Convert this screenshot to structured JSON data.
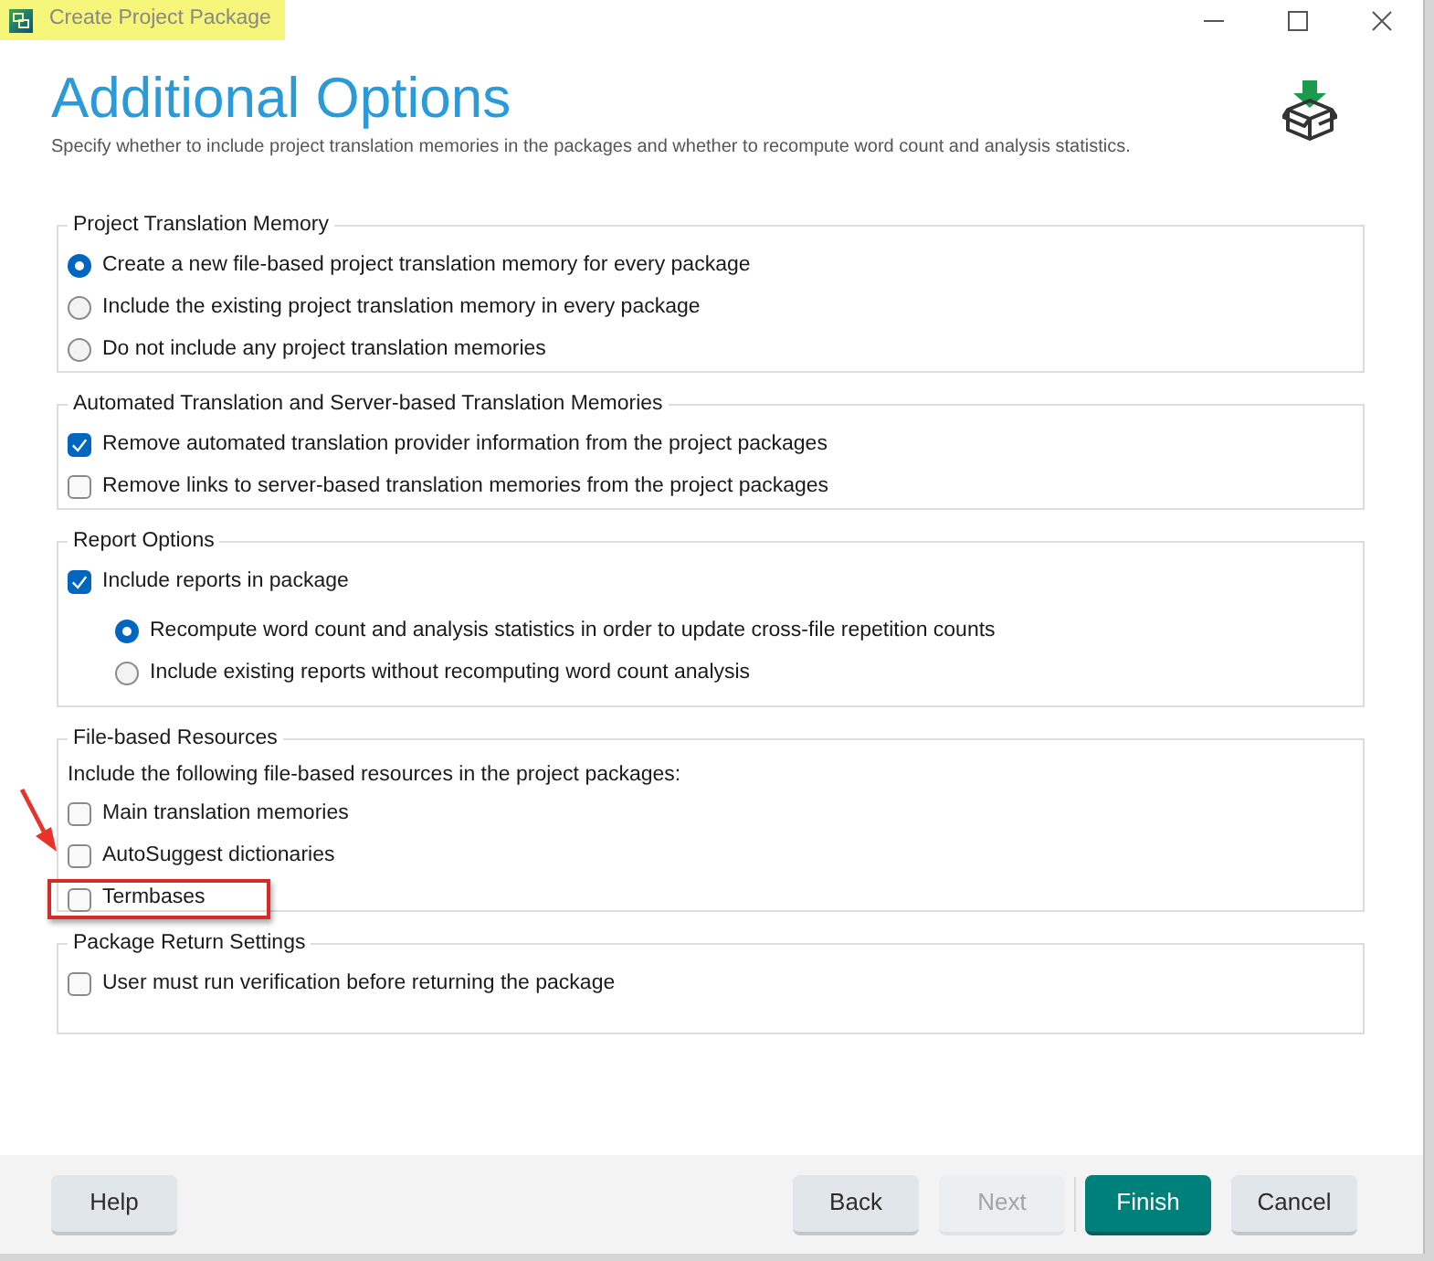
{
  "window": {
    "title": "Create Project Package",
    "highlighted": true
  },
  "header": {
    "title": "Additional Options",
    "subtitle": "Specify whether to include project translation memories in the packages and whether to recompute word count and analysis statistics."
  },
  "groups": [
    {
      "legend": "Project Translation Memory",
      "items": [
        {
          "kind": "radio",
          "label": "Create a new file-based project translation memory for every package",
          "selected": true
        },
        {
          "kind": "radio",
          "label": "Include the existing project translation memory in every package",
          "selected": false
        },
        {
          "kind": "radio",
          "label": "Do not include any project translation memories",
          "selected": false
        }
      ]
    },
    {
      "legend": "Automated Translation and Server-based Translation Memories",
      "items": [
        {
          "kind": "checkbox",
          "label": "Remove automated translation provider information from the project packages",
          "checked": true
        },
        {
          "kind": "checkbox",
          "label": "Remove links to server-based translation memories from the project packages",
          "checked": false
        }
      ]
    },
    {
      "legend": "Report Options",
      "items": [
        {
          "kind": "checkbox",
          "label": "Include reports in package",
          "checked": true,
          "children": [
            {
              "kind": "radio",
              "label": "Recompute word count and analysis statistics in order to update cross-file repetition counts",
              "selected": true
            },
            {
              "kind": "radio",
              "label": "Include existing reports without recomputing word count analysis",
              "selected": false
            }
          ]
        }
      ]
    },
    {
      "legend": "File-based Resources",
      "items": [
        {
          "kind": "text",
          "label": "Include the following file-based resources in the project packages:",
          "annotated": false
        },
        {
          "kind": "checkbox",
          "label": "Main translation memories",
          "checked": false,
          "annotated": false
        },
        {
          "kind": "checkbox",
          "label": "AutoSuggest dictionaries",
          "checked": false,
          "annotated": false
        },
        {
          "kind": "checkbox",
          "label": "Termbases",
          "checked": false,
          "annotated": true
        }
      ]
    },
    {
      "legend": "Package Return Settings",
      "items": [
        {
          "kind": "checkbox",
          "label": "User must run verification before returning the package",
          "checked": false
        }
      ]
    }
  ],
  "footer": {
    "left_buttons": [
      {
        "label": "Help",
        "kind": "standard",
        "disabled": false
      }
    ],
    "right_buttons": [
      {
        "label": "Back",
        "kind": "standard",
        "disabled": false
      },
      {
        "label": "Next",
        "kind": "standard",
        "disabled": true
      },
      {
        "label": "Finish",
        "kind": "primary",
        "disabled": false
      },
      {
        "label": "Cancel",
        "kind": "standard",
        "disabled": false
      }
    ]
  }
}
